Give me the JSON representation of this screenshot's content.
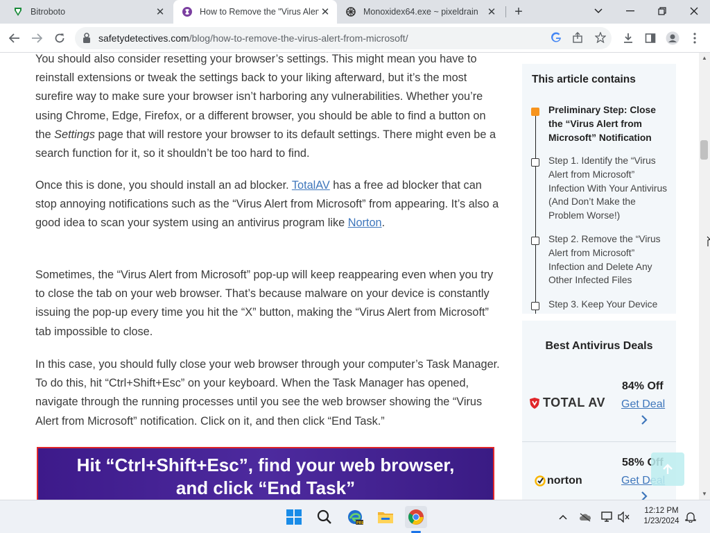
{
  "tabs": [
    {
      "title": "Bitroboto",
      "icon": "bitroboto-favicon",
      "active": false
    },
    {
      "title": "How to Remove the \"Virus Alert f",
      "icon": "safetydetectives-favicon",
      "active": true
    },
    {
      "title": "Monoxidex64.exe ~ pixeldrain",
      "icon": "pixeldrain-favicon",
      "active": false
    }
  ],
  "address": {
    "host": "safetydetectives.com",
    "path": "/blog/how-to-remove-the-virus-alert-from-microsoft/"
  },
  "article": {
    "p1": {
      "a": "You should also consider resetting your browser’s settings. This might mean you have to reinstall extensions or tweak the settings back to your liking afterward, but it’s the most surefire way to make sure your browser isn’t harboring any vulnerabilities. Whether you’re using Chrome, Edge, Firefox, or a different browser, you should be able to find a button on the ",
      "em": "Settings",
      "b": " page that will restore your browser to its default settings. There might even be a search function for it, so it shouldn’t be too hard to find."
    },
    "p2": {
      "a": "Once this is done, you should install an ad blocker. ",
      "link1": "TotalAV",
      "b": " has a free ad blocker that can stop annoying notifications such as the “Virus Alert from Microsoft” from appearing. It’s also a good idea to scan your system using an antivirus program like ",
      "link2": "Norton",
      "c": "."
    },
    "p3": "Sometimes, the “Virus Alert from Microsoft” pop-up will keep reappearing even when you try to close the tab on your web browser. That’s because malware on your device is constantly issuing the pop-up every time you hit the “X” button, making the “Virus Alert from Microsoft” tab impossible to close.",
    "p4": "In this case, you should fully close your web browser through your computer’s Task Manager. To do this, hit “Ctrl+Shift+Esc” on your keyboard. When the Task Manager has opened, navigate through the running processes until you see the web browser showing the “Virus Alert from Microsoft” notification. Click on it, and then click “End Task.”",
    "banner_line1": "Hit “Ctrl+Shift+Esc”, find your web browser,",
    "banner_line2": "and click “End Task”"
  },
  "toc": {
    "title": "This article contains",
    "items": [
      "Preliminary Step: Close the “Virus Alert from Microsoft” Notification",
      "Step 1. Identify the “Virus Alert from Microsoft” Infection With Your Antivirus (And Don’t Make the Problem Worse!)",
      "Step 2. Remove the “Virus Alert from Microsoft” Infection and Delete Any Other Infected Files",
      "Step 3. Keep Your Device"
    ]
  },
  "deals": {
    "title": "Best Antivirus Deals",
    "items": [
      {
        "brand": "TOTAL AV",
        "off": "84% Off",
        "link": "Get Deal"
      },
      {
        "brand": "norton",
        "off": "58% Off",
        "link": "Get Deal"
      }
    ]
  },
  "clock": {
    "time": "12:12 PM",
    "date": "1/23/2024"
  },
  "colors": {
    "accent": "#f7941d",
    "link": "#3e76bb",
    "banner_bg": "#4d2a9e",
    "banner_border": "#e0262a"
  }
}
